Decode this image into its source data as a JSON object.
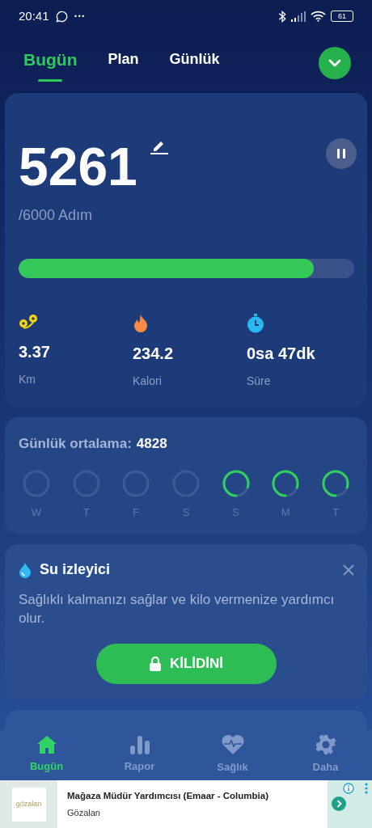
{
  "status_bar": {
    "time": "20:41",
    "dots": "···",
    "battery": "61"
  },
  "tabs": [
    {
      "label": "Bugün",
      "selected": true
    },
    {
      "label": "Plan",
      "selected": false
    },
    {
      "label": "Günlük",
      "selected": false
    }
  ],
  "steps": {
    "count": "5261",
    "goal": "/6000 Adım",
    "level": 0.88
  },
  "stats": [
    {
      "kind": "distance",
      "value": "3.37",
      "label": "Km"
    },
    {
      "kind": "calories",
      "value": "234.2",
      "label": "Kalori"
    },
    {
      "kind": "time",
      "value": "0sa 47dk",
      "label": "Süre"
    }
  ],
  "average": {
    "label": "Günlük ortalama:",
    "value": "4828"
  },
  "days": [
    {
      "label": "W",
      "active": false
    },
    {
      "label": "T",
      "active": false
    },
    {
      "label": "F",
      "active": false
    },
    {
      "label": "S",
      "active": false
    },
    {
      "label": "S",
      "active": true
    },
    {
      "label": "M",
      "active": true
    },
    {
      "label": "T",
      "active": true
    }
  ],
  "water": {
    "title": "Su izleyici",
    "text": "Sağlıklı kalmanızı sağlar ve kilo vermenize yardımcı olur.",
    "button": "KİLİDİNİ"
  },
  "bottom_nav": [
    {
      "kind": "home",
      "label": "Bugün",
      "selected": true
    },
    {
      "kind": "report",
      "label": "Rapor",
      "selected": false
    },
    {
      "kind": "health",
      "label": "Sağlık",
      "selected": false
    },
    {
      "kind": "more",
      "label": "Daha",
      "selected": false
    }
  ],
  "ad": {
    "logo_text": "gözalan",
    "title": "Mağaza Müdür Yardımcısı (Emaar - Columbia)",
    "advertiser": "Gözalan"
  }
}
